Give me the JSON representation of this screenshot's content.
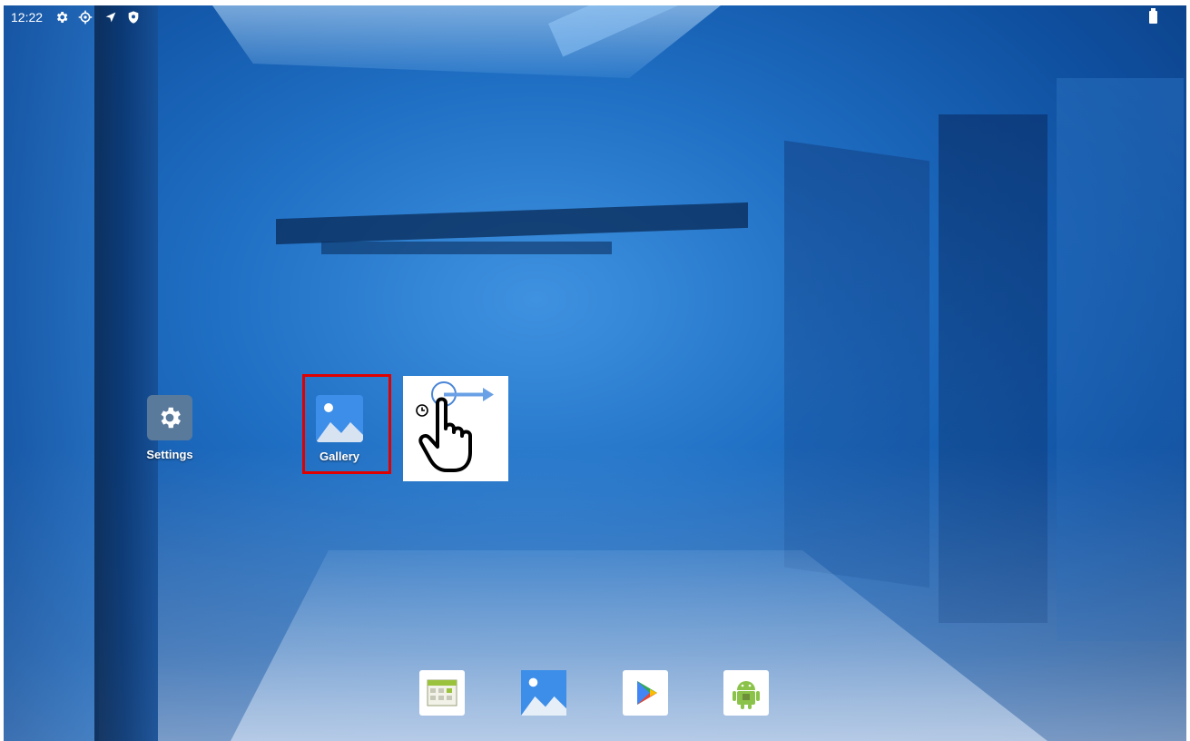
{
  "status_bar": {
    "time": "12:22",
    "icons": [
      "settings-gear-icon",
      "crosshair-target-icon",
      "location-arrow-icon",
      "shield-icon"
    ],
    "battery_icon": "battery-icon"
  },
  "desktop": {
    "apps": [
      {
        "name": "settings",
        "label": "Settings",
        "icon": "gear-icon"
      },
      {
        "name": "gallery",
        "label": "Gallery",
        "icon": "image-icon",
        "highlighted": true
      }
    ]
  },
  "gesture_hint": {
    "icon": "swipe-hand-gesture-icon",
    "sub_icons": [
      "clock-icon",
      "right-arrow-icon"
    ]
  },
  "dock": {
    "items": [
      {
        "name": "calendar-app",
        "icon": "calendar-grid-icon"
      },
      {
        "name": "gallery-app",
        "icon": "image-icon"
      },
      {
        "name": "play-store-app",
        "icon": "play-store-icon"
      },
      {
        "name": "android-app",
        "icon": "android-robot-icon"
      }
    ]
  },
  "colors": {
    "highlight": "#e00000",
    "wallpaper_primary": "#1f6fc4",
    "settings_tile": "#5a7a9c",
    "gallery_blue": "#3d8ee8"
  }
}
